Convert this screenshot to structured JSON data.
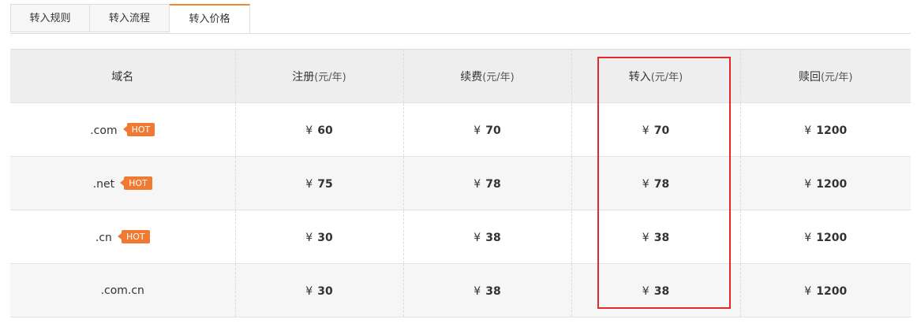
{
  "tabs": [
    {
      "label": "转入规则"
    },
    {
      "label": "转入流程"
    },
    {
      "label": "转入价格"
    }
  ],
  "active_tab": "转入价格",
  "table": {
    "headers": [
      {
        "label": "域名",
        "unit": ""
      },
      {
        "label": "注册",
        "unit": "(元/年)"
      },
      {
        "label": "续费",
        "unit": "(元/年)"
      },
      {
        "label": "转入",
        "unit": "(元/年)"
      },
      {
        "label": "赎回",
        "unit": "(元/年)"
      }
    ],
    "currency": "¥",
    "hot_label": "HOT",
    "rows": [
      {
        "domain": ".com",
        "hot": true,
        "register": "60",
        "renew": "70",
        "transfer": "70",
        "redeem": "1200"
      },
      {
        "domain": ".net",
        "hot": true,
        "register": "75",
        "renew": "78",
        "transfer": "78",
        "redeem": "1200"
      },
      {
        "domain": ".cn",
        "hot": true,
        "register": "30",
        "renew": "38",
        "transfer": "38",
        "redeem": "1200"
      },
      {
        "domain": ".com.cn",
        "hot": false,
        "register": "30",
        "renew": "38",
        "transfer": "38",
        "redeem": "1200"
      }
    ]
  },
  "colors": {
    "accent": "#f08a2e",
    "hot_badge": "#f07a31",
    "highlight_box": "#e02a2a"
  }
}
